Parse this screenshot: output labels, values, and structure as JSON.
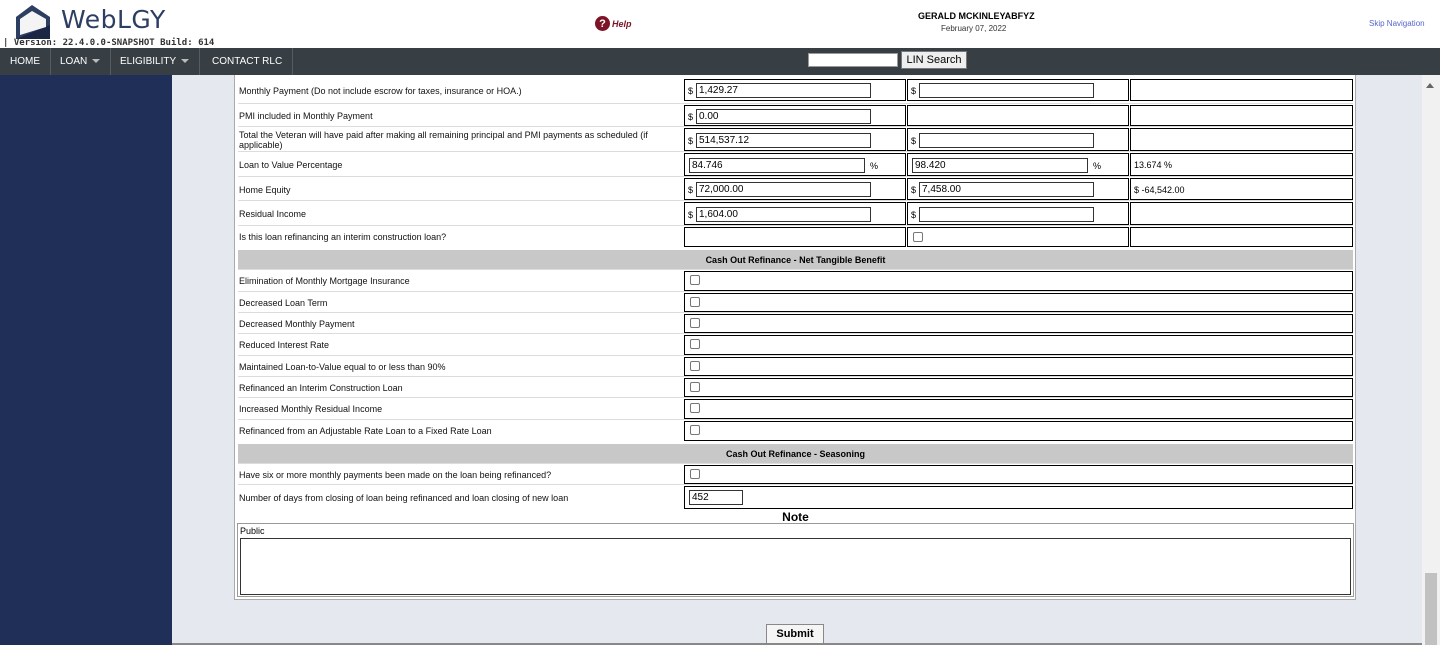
{
  "header": {
    "logo_text": "WebLGY",
    "version": "| Version: 22.4.0.0-SNAPSHOT Build: 614",
    "help_label": "Help",
    "help_icon_glyph": "?",
    "user_name": "GERALD MCKINLEYABFYZ",
    "date": "February 07, 2022",
    "skip_nav": "Skip Navigation"
  },
  "nav": {
    "home": "HOME",
    "loan": "LOAN",
    "eligibility": "ELIGIBILITY",
    "contact": "CONTACT RLC",
    "search_value": "",
    "search_button": "LIN Search"
  },
  "rows": {
    "monthly_payment": {
      "label": "Monthly Payment (Do not include escrow for taxes, insurance or HOA.)",
      "c1_value": "1,429.27",
      "c2_value": ""
    },
    "pmi": {
      "label": "PMI included in Monthly Payment",
      "c1_value": "0.00"
    },
    "total_paid": {
      "label": "Total the Veteran will have paid after making all remaining principal and PMI payments as scheduled (if applicable)",
      "c1_value": "514,537.12",
      "c2_value": ""
    },
    "ltv": {
      "label": "Loan to Value Percentage",
      "c1_value": "84.746",
      "c2_value": "98.420",
      "c3_value": "13.674 %"
    },
    "home_equity": {
      "label": "Home Equity",
      "c1_value": "72,000.00",
      "c2_value": "7,458.00",
      "c3_value": "$ -64,542.00"
    },
    "residual": {
      "label": "Residual Income",
      "c1_value": "1,604.00",
      "c2_value": ""
    },
    "interim": {
      "label": "Is this loan refinancing an interim construction loan?"
    }
  },
  "currency_symbol": "$",
  "percent_symbol": "%",
  "ntb": {
    "title": "Cash Out Refinance - Net Tangible Benefit",
    "items": [
      "Elimination of Monthly Mortgage Insurance",
      "Decreased Loan Term",
      "Decreased Monthly Payment",
      "Reduced Interest Rate",
      "Maintained Loan-to-Value equal to or less than 90%",
      "Refinanced an Interim Construction Loan",
      "Increased Monthly Residual Income",
      "Refinanced from an Adjustable Rate Loan to a Fixed Rate Loan"
    ]
  },
  "seasoning": {
    "title": "Cash Out Refinance - Seasoning",
    "six_payments_label": "Have six or more monthly payments been made on the loan being refinanced?",
    "days_label": "Number of days from closing of loan being refinanced and loan closing of new loan",
    "days_value": "452"
  },
  "note": {
    "title": "Note",
    "public_label": "Public",
    "public_value": ""
  },
  "submit_label": "Submit",
  "colors": {
    "nav_bg": "#373f45",
    "sidebar_bg": "#1f2f57",
    "section_header_bg": "#c8c8c8",
    "help_color": "#7d1326"
  }
}
